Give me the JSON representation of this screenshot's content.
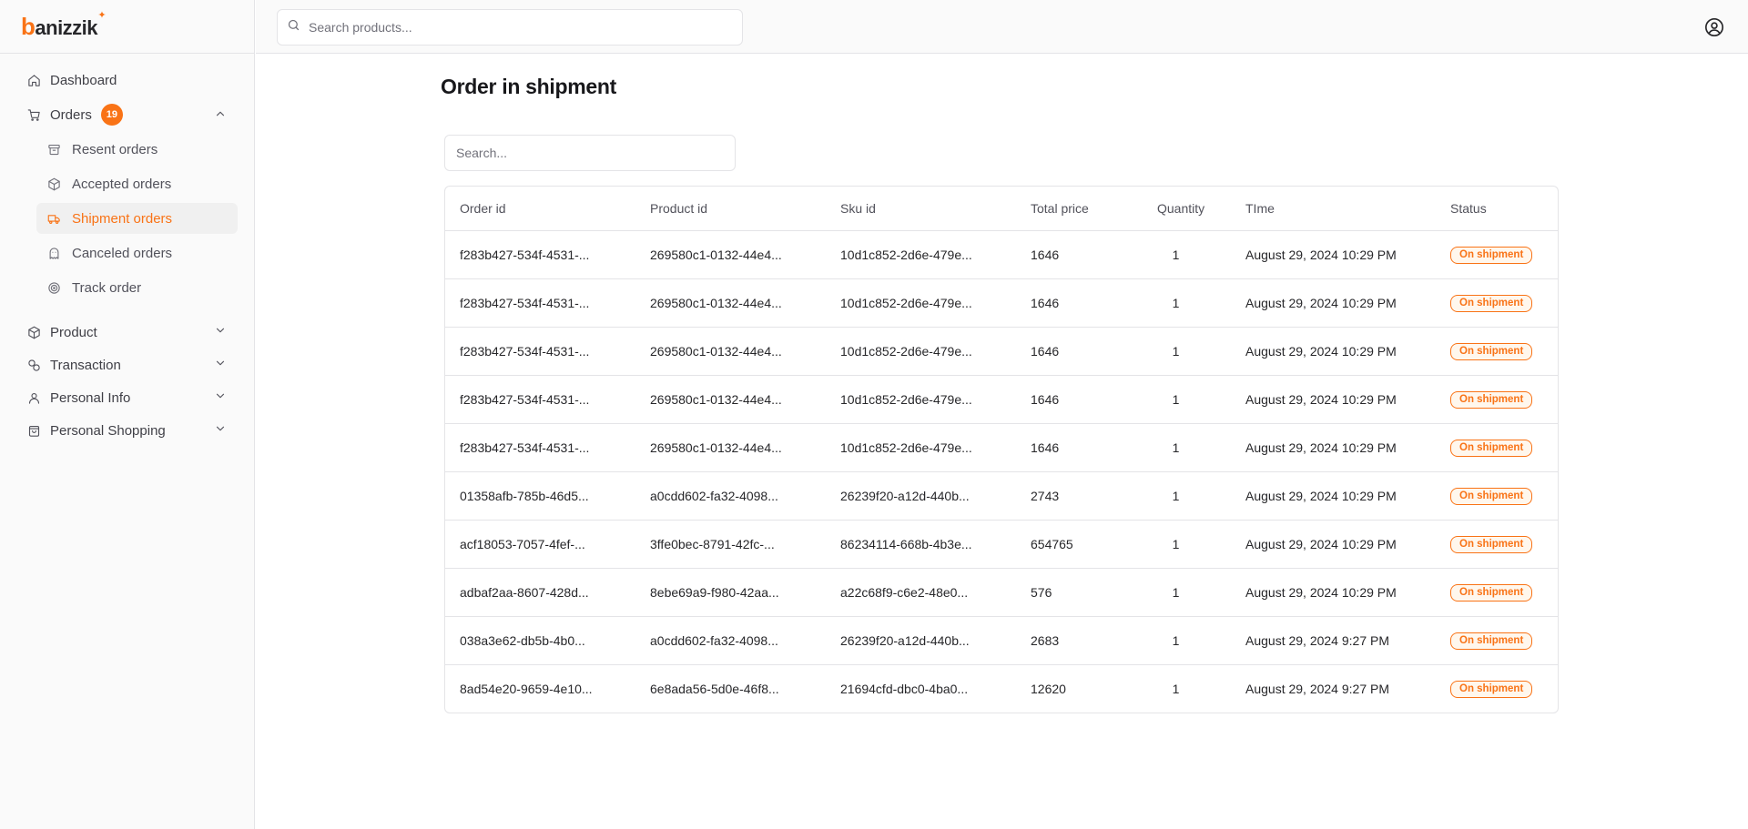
{
  "brand": {
    "logo_text": "banizzik",
    "accent": "#f97316"
  },
  "topbar": {
    "search_placeholder": "Search products..."
  },
  "sidebar": {
    "dashboard": "Dashboard",
    "orders": {
      "label": "Orders",
      "badge": "19"
    },
    "sub_items": [
      {
        "label": "Resent orders",
        "icon": "archive-icon"
      },
      {
        "label": "Accepted orders",
        "icon": "package-icon"
      },
      {
        "label": "Shipment orders",
        "icon": "truck-icon",
        "active": true
      },
      {
        "label": "Canceled orders",
        "icon": "ghost-icon"
      },
      {
        "label": "Track order",
        "icon": "target-icon"
      }
    ],
    "groups": [
      {
        "label": "Product",
        "icon": "package-icon"
      },
      {
        "label": "Transaction",
        "icon": "transaction-icon"
      },
      {
        "label": "Personal Info",
        "icon": "user-icon"
      },
      {
        "label": "Personal Shopping",
        "icon": "shopping-bag-icon"
      }
    ]
  },
  "main": {
    "title": "Order in shipment",
    "search_placeholder": "Search...",
    "columns": [
      "Order id",
      "Product id",
      "Sku id",
      "Total price",
      "Quantity",
      "TIme",
      "Status"
    ],
    "rows": [
      {
        "order_id": "f283b427-534f-4531-...",
        "product_id": "269580c1-0132-44e4...",
        "sku_id": "10d1c852-2d6e-479e...",
        "total": "1646",
        "qty": "1",
        "time": "August 29, 2024 10:29 PM",
        "status": "On shipment"
      },
      {
        "order_id": "f283b427-534f-4531-...",
        "product_id": "269580c1-0132-44e4...",
        "sku_id": "10d1c852-2d6e-479e...",
        "total": "1646",
        "qty": "1",
        "time": "August 29, 2024 10:29 PM",
        "status": "On shipment"
      },
      {
        "order_id": "f283b427-534f-4531-...",
        "product_id": "269580c1-0132-44e4...",
        "sku_id": "10d1c852-2d6e-479e...",
        "total": "1646",
        "qty": "1",
        "time": "August 29, 2024 10:29 PM",
        "status": "On shipment"
      },
      {
        "order_id": "f283b427-534f-4531-...",
        "product_id": "269580c1-0132-44e4...",
        "sku_id": "10d1c852-2d6e-479e...",
        "total": "1646",
        "qty": "1",
        "time": "August 29, 2024 10:29 PM",
        "status": "On shipment"
      },
      {
        "order_id": "f283b427-534f-4531-...",
        "product_id": "269580c1-0132-44e4...",
        "sku_id": "10d1c852-2d6e-479e...",
        "total": "1646",
        "qty": "1",
        "time": "August 29, 2024 10:29 PM",
        "status": "On shipment"
      },
      {
        "order_id": "01358afb-785b-46d5...",
        "product_id": "a0cdd602-fa32-4098...",
        "sku_id": "26239f20-a12d-440b...",
        "total": "2743",
        "qty": "1",
        "time": "August 29, 2024 10:29 PM",
        "status": "On shipment"
      },
      {
        "order_id": "acf18053-7057-4fef-...",
        "product_id": "3ffe0bec-8791-42fc-...",
        "sku_id": "86234114-668b-4b3e...",
        "total": "654765",
        "qty": "1",
        "time": "August 29, 2024 10:29 PM",
        "status": "On shipment"
      },
      {
        "order_id": "adbaf2aa-8607-428d...",
        "product_id": "8ebe69a9-f980-42aa...",
        "sku_id": "a22c68f9-c6e2-48e0...",
        "total": "576",
        "qty": "1",
        "time": "August 29, 2024 10:29 PM",
        "status": "On shipment"
      },
      {
        "order_id": "038a3e62-db5b-4b0...",
        "product_id": "a0cdd602-fa32-4098...",
        "sku_id": "26239f20-a12d-440b...",
        "total": "2683",
        "qty": "1",
        "time": "August 29, 2024 9:27 PM",
        "status": "On shipment"
      },
      {
        "order_id": "8ad54e20-9659-4e10...",
        "product_id": "6e8ada56-5d0e-46f8...",
        "sku_id": "21694cfd-dbc0-4ba0...",
        "total": "12620",
        "qty": "1",
        "time": "August 29, 2024 9:27 PM",
        "status": "On shipment"
      }
    ]
  }
}
